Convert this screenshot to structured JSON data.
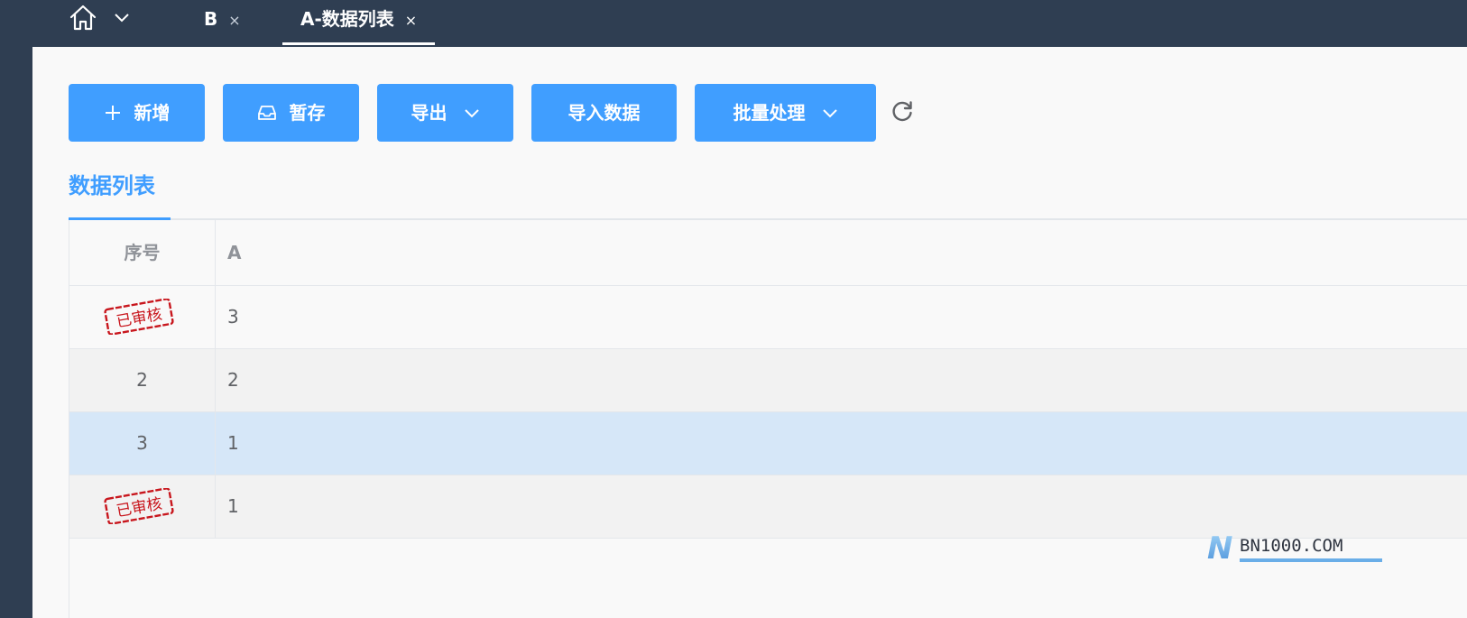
{
  "tabs": {
    "home_icon": "home-icon",
    "home_chevron_icon": "chevron-down-icon",
    "items": [
      {
        "label": "B",
        "close": "×"
      },
      {
        "label": "A-数据列表",
        "close": "×"
      }
    ]
  },
  "toolbar": {
    "add_label": "新增",
    "save_label": "暂存",
    "export_label": "导出",
    "import_label": "导入数据",
    "batch_label": "批量处理"
  },
  "section": {
    "tab_label": "数据列表"
  },
  "table": {
    "headers": [
      "序号",
      "A"
    ],
    "rows": [
      {
        "seq": "",
        "stamp": "已审核",
        "a": "3"
      },
      {
        "seq": "2",
        "stamp": "",
        "a": "2"
      },
      {
        "seq": "3",
        "stamp": "",
        "a": "1"
      },
      {
        "seq": "",
        "stamp": "已审核",
        "a": "1"
      }
    ]
  },
  "watermark": {
    "text": "BN1000.COM",
    "letter": "N"
  },
  "colors": {
    "accent": "#409eff",
    "topbar": "#2f3e52",
    "selected_row": "#d6e7f8",
    "stamp_red": "#c8161d"
  }
}
